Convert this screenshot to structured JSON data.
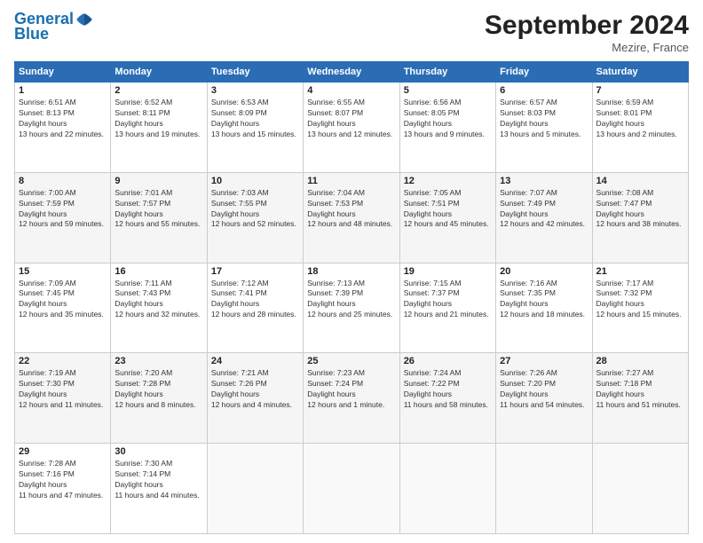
{
  "header": {
    "logo_line1": "General",
    "logo_line2": "Blue",
    "month_title": "September 2024",
    "location": "Mezire, France"
  },
  "days_of_week": [
    "Sunday",
    "Monday",
    "Tuesday",
    "Wednesday",
    "Thursday",
    "Friday",
    "Saturday"
  ],
  "weeks": [
    [
      {
        "day": "1",
        "sunrise": "6:51 AM",
        "sunset": "8:13 PM",
        "daylight": "13 hours and 22 minutes."
      },
      {
        "day": "2",
        "sunrise": "6:52 AM",
        "sunset": "8:11 PM",
        "daylight": "13 hours and 19 minutes."
      },
      {
        "day": "3",
        "sunrise": "6:53 AM",
        "sunset": "8:09 PM",
        "daylight": "13 hours and 15 minutes."
      },
      {
        "day": "4",
        "sunrise": "6:55 AM",
        "sunset": "8:07 PM",
        "daylight": "13 hours and 12 minutes."
      },
      {
        "day": "5",
        "sunrise": "6:56 AM",
        "sunset": "8:05 PM",
        "daylight": "13 hours and 9 minutes."
      },
      {
        "day": "6",
        "sunrise": "6:57 AM",
        "sunset": "8:03 PM",
        "daylight": "13 hours and 5 minutes."
      },
      {
        "day": "7",
        "sunrise": "6:59 AM",
        "sunset": "8:01 PM",
        "daylight": "13 hours and 2 minutes."
      }
    ],
    [
      {
        "day": "8",
        "sunrise": "7:00 AM",
        "sunset": "7:59 PM",
        "daylight": "12 hours and 59 minutes."
      },
      {
        "day": "9",
        "sunrise": "7:01 AM",
        "sunset": "7:57 PM",
        "daylight": "12 hours and 55 minutes."
      },
      {
        "day": "10",
        "sunrise": "7:03 AM",
        "sunset": "7:55 PM",
        "daylight": "12 hours and 52 minutes."
      },
      {
        "day": "11",
        "sunrise": "7:04 AM",
        "sunset": "7:53 PM",
        "daylight": "12 hours and 48 minutes."
      },
      {
        "day": "12",
        "sunrise": "7:05 AM",
        "sunset": "7:51 PM",
        "daylight": "12 hours and 45 minutes."
      },
      {
        "day": "13",
        "sunrise": "7:07 AM",
        "sunset": "7:49 PM",
        "daylight": "12 hours and 42 minutes."
      },
      {
        "day": "14",
        "sunrise": "7:08 AM",
        "sunset": "7:47 PM",
        "daylight": "12 hours and 38 minutes."
      }
    ],
    [
      {
        "day": "15",
        "sunrise": "7:09 AM",
        "sunset": "7:45 PM",
        "daylight": "12 hours and 35 minutes."
      },
      {
        "day": "16",
        "sunrise": "7:11 AM",
        "sunset": "7:43 PM",
        "daylight": "12 hours and 32 minutes."
      },
      {
        "day": "17",
        "sunrise": "7:12 AM",
        "sunset": "7:41 PM",
        "daylight": "12 hours and 28 minutes."
      },
      {
        "day": "18",
        "sunrise": "7:13 AM",
        "sunset": "7:39 PM",
        "daylight": "12 hours and 25 minutes."
      },
      {
        "day": "19",
        "sunrise": "7:15 AM",
        "sunset": "7:37 PM",
        "daylight": "12 hours and 21 minutes."
      },
      {
        "day": "20",
        "sunrise": "7:16 AM",
        "sunset": "7:35 PM",
        "daylight": "12 hours and 18 minutes."
      },
      {
        "day": "21",
        "sunrise": "7:17 AM",
        "sunset": "7:32 PM",
        "daylight": "12 hours and 15 minutes."
      }
    ],
    [
      {
        "day": "22",
        "sunrise": "7:19 AM",
        "sunset": "7:30 PM",
        "daylight": "12 hours and 11 minutes."
      },
      {
        "day": "23",
        "sunrise": "7:20 AM",
        "sunset": "7:28 PM",
        "daylight": "12 hours and 8 minutes."
      },
      {
        "day": "24",
        "sunrise": "7:21 AM",
        "sunset": "7:26 PM",
        "daylight": "12 hours and 4 minutes."
      },
      {
        "day": "25",
        "sunrise": "7:23 AM",
        "sunset": "7:24 PM",
        "daylight": "12 hours and 1 minute."
      },
      {
        "day": "26",
        "sunrise": "7:24 AM",
        "sunset": "7:22 PM",
        "daylight": "11 hours and 58 minutes."
      },
      {
        "day": "27",
        "sunrise": "7:26 AM",
        "sunset": "7:20 PM",
        "daylight": "11 hours and 54 minutes."
      },
      {
        "day": "28",
        "sunrise": "7:27 AM",
        "sunset": "7:18 PM",
        "daylight": "11 hours and 51 minutes."
      }
    ],
    [
      {
        "day": "29",
        "sunrise": "7:28 AM",
        "sunset": "7:16 PM",
        "daylight": "11 hours and 47 minutes."
      },
      {
        "day": "30",
        "sunrise": "7:30 AM",
        "sunset": "7:14 PM",
        "daylight": "11 hours and 44 minutes."
      },
      null,
      null,
      null,
      null,
      null
    ]
  ]
}
